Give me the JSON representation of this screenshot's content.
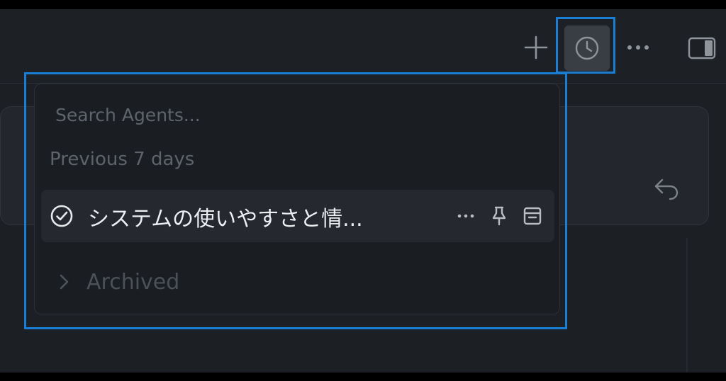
{
  "toolbar": {
    "new_agent_icon": "plus-icon",
    "history_icon": "clock-icon",
    "more_icon": "ellipsis-icon",
    "panel_icon": "sidebar-toggle-icon"
  },
  "composer": {
    "undo_icon": "undo-icon"
  },
  "history_popover": {
    "search": {
      "placeholder": "Search Agents...",
      "value": ""
    },
    "sections": [
      {
        "label": "Previous 7 days",
        "items": [
          {
            "title": "システムの使いやすさと情...",
            "status_icon": "check-circle-icon",
            "actions": [
              "ellipsis-icon",
              "pin-icon",
              "archive-icon"
            ]
          }
        ]
      }
    ],
    "archived": {
      "label": "Archived",
      "icon": "chevron-right-icon",
      "expanded": false
    }
  },
  "colors": {
    "background": "#1c1f24",
    "popover": "#1a1d22",
    "selected_row": "#25282e",
    "highlight_outline": "#1a7fd4"
  }
}
